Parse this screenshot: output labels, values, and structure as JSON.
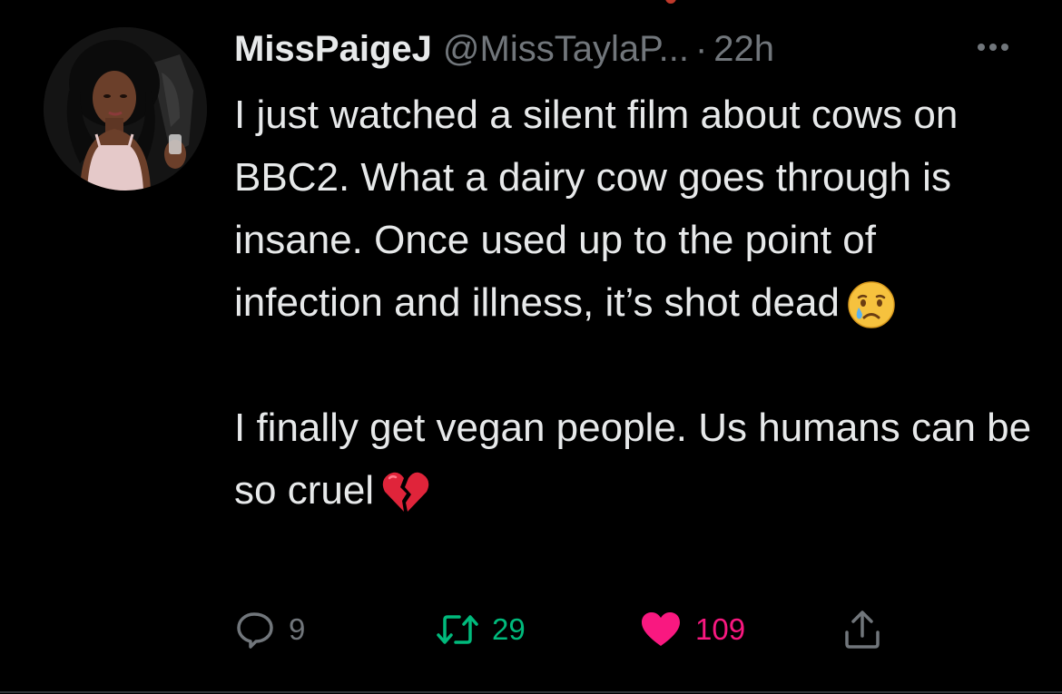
{
  "tweet": {
    "author": {
      "display_name": "MissPaigeJ",
      "handle": "@MissTaylaP...",
      "avatar": "profile-photo"
    },
    "separator": "·",
    "timestamp": "22h",
    "more_icon": "more-horizontal-icon",
    "text": {
      "paragraph1": "I just watched a silent film about cows on BBC2. What a dairy cow goes through is insane. Once used up to the point of infection and illness, it’s shot dead",
      "paragraph1_emoji": "crying-face-emoji",
      "paragraph2": "I finally get vegan people. Us humans can be so cruel",
      "paragraph2_emoji": "broken-heart-emoji"
    },
    "actions": {
      "reply": {
        "icon": "reply-icon",
        "count": "9"
      },
      "retweet": {
        "icon": "retweet-icon",
        "count": "29"
      },
      "like": {
        "icon": "heart-filled-icon",
        "count": "109",
        "liked": true
      },
      "share": {
        "icon": "share-icon"
      }
    }
  },
  "colors": {
    "background": "#000000",
    "text_primary": "#e7e9ea",
    "text_secondary": "#71767b",
    "retweet_green": "#00ba7c",
    "like_pink": "#f91880"
  }
}
